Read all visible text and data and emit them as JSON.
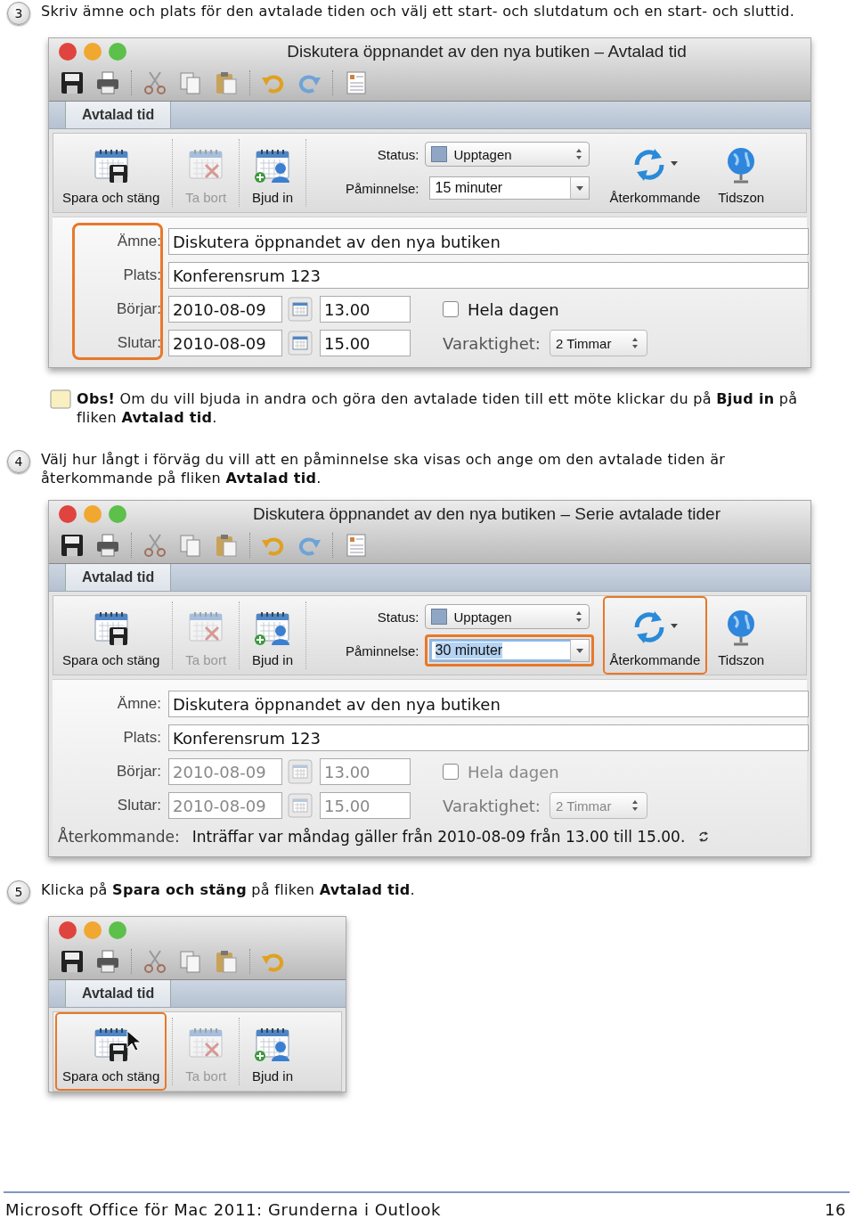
{
  "steps": [
    {
      "number": "3",
      "text": "Skriv ämne och plats för den avtalade tiden och välj ett start- och slutdatum och en start- och sluttid.",
      "window": {
        "title": "Diskutera öppnandet av den nya butiken – Avtalad tid",
        "compact": false,
        "tab": {
          "label": "Avtalad tid",
          "selected": true
        },
        "ribbon": {
          "buttons": [
            {
              "label": "Spara och stäng",
              "kind": "save",
              "disabled": false,
              "highlighted": false,
              "pointer": false
            },
            {
              "label": "Ta bort",
              "kind": "delete",
              "disabled": true,
              "highlighted": false,
              "pointer": false
            },
            {
              "label": "Bjud in",
              "kind": "invite",
              "disabled": false,
              "highlighted": false,
              "pointer": false
            }
          ],
          "status": {
            "label": "Status:",
            "value": "Upptagen"
          },
          "reminder": {
            "label": "Påminnelse:",
            "value": "15 minuter",
            "highlighted": false,
            "value_selected": false
          },
          "recurrence": {
            "label": "Återkommande",
            "highlighted": false
          },
          "timezone": {
            "label": "Tidszon"
          }
        },
        "form": {
          "labels_highlighted": true,
          "times_disabled": false,
          "subject": {
            "label": "Ämne:",
            "value": "Diskutera öppnandet av den nya butiken"
          },
          "location": {
            "label": "Plats:",
            "value": "Konferensrum 123"
          },
          "start": {
            "label": "Börjar:",
            "date": "2010-08-09",
            "time": "13.00"
          },
          "end": {
            "label": "Slutar:",
            "date": "2010-08-09",
            "time": "15.00"
          },
          "all_day": {
            "label": "Hela dagen",
            "checked": false
          },
          "duration": {
            "label": "Varaktighet:",
            "value": "2 Timmar"
          }
        }
      },
      "note": {
        "text": "**Obs!** Om du vill bjuda in andra och göra den avtalade tiden till ett möte klickar du på **Bjud in** på fliken **Avtalad tid**."
      }
    },
    {
      "number": "4",
      "text": "Välj hur långt i förväg du vill att en påminnelse ska visas och ange om den avtalade tiden är återkommande på fliken **Avtalad tid**.",
      "window": {
        "title": "Diskutera öppnandet av den nya butiken – Serie avtalade tider",
        "compact": false,
        "tab": {
          "label": "Avtalad tid",
          "selected": true
        },
        "ribbon": {
          "buttons": [
            {
              "label": "Spara och stäng",
              "kind": "save",
              "disabled": false,
              "highlighted": false,
              "pointer": false
            },
            {
              "label": "Ta bort",
              "kind": "delete",
              "disabled": true,
              "highlighted": false,
              "pointer": false
            },
            {
              "label": "Bjud in",
              "kind": "invite",
              "disabled": false,
              "highlighted": false,
              "pointer": false
            }
          ],
          "status": {
            "label": "Status:",
            "value": "Upptagen"
          },
          "reminder": {
            "label": "Påminnelse:",
            "value": "30 minuter",
            "highlighted": true,
            "value_selected": true
          },
          "recurrence": {
            "label": "Återkommande",
            "highlighted": true
          },
          "timezone": {
            "label": "Tidszon"
          }
        },
        "form": {
          "labels_highlighted": false,
          "times_disabled": true,
          "subject": {
            "label": "Ämne:",
            "value": "Diskutera öppnandet av den nya butiken"
          },
          "location": {
            "label": "Plats:",
            "value": "Konferensrum 123"
          },
          "start": {
            "label": "Börjar:",
            "date": "2010-08-09",
            "time": "13.00"
          },
          "end": {
            "label": "Slutar:",
            "date": "2010-08-09",
            "time": "15.00"
          },
          "all_day": {
            "label": "Hela dagen",
            "checked": false
          },
          "duration": {
            "label": "Varaktighet:",
            "value": "2 Timmar"
          },
          "recurrence": {
            "label": "Återkommande:",
            "text": "Inträffar var måndag gäller från 2010-08-09 från 13.00 till 15.00."
          }
        }
      }
    },
    {
      "number": "5",
      "text": "Klicka på **Spara och stäng** på fliken **Avtalad tid**.",
      "window": {
        "compact": true,
        "tab": {
          "label": "Avtalad tid",
          "selected": true
        },
        "ribbon": {
          "buttons": [
            {
              "label": "Spara och stäng",
              "kind": "save",
              "disabled": false,
              "highlighted": true,
              "pointer": true
            },
            {
              "label": "Ta bort",
              "kind": "delete",
              "disabled": true,
              "highlighted": false,
              "pointer": false
            },
            {
              "label": "Bjud in",
              "kind": "invite",
              "disabled": false,
              "highlighted": false,
              "pointer": false
            }
          ]
        }
      }
    }
  ],
  "footer": {
    "title": "Microsoft Office för Mac 2011: Grunderna i Outlook",
    "page": "16"
  }
}
